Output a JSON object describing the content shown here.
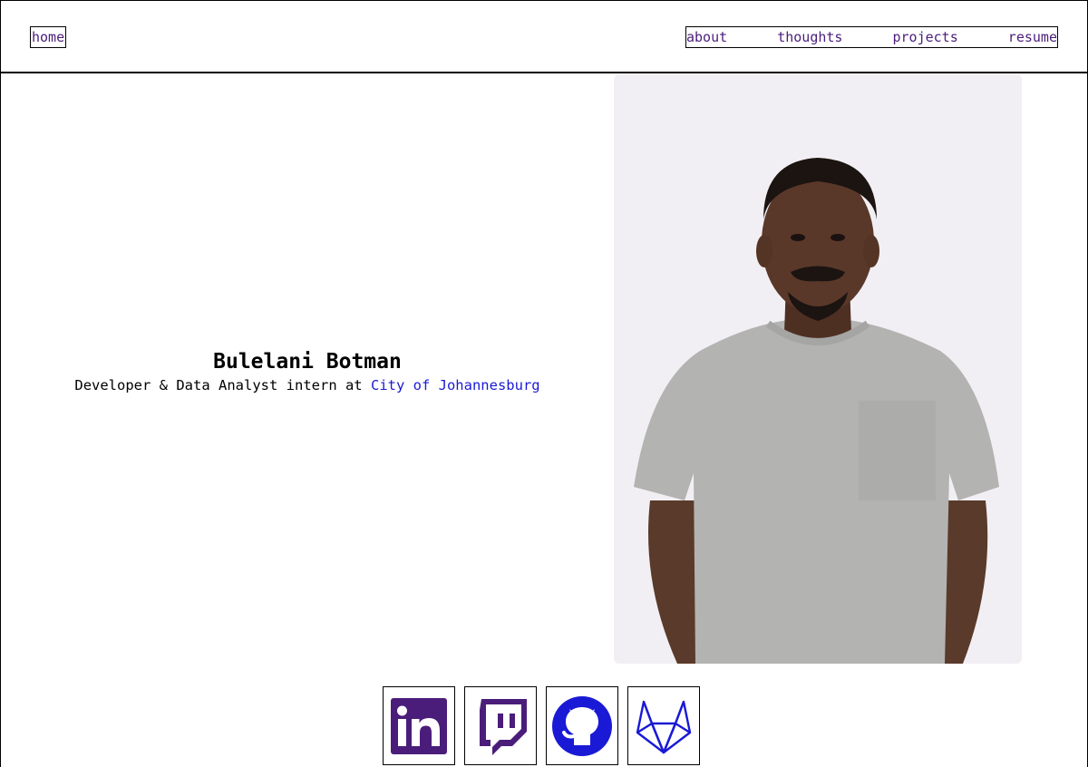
{
  "nav": {
    "home": "home",
    "links": [
      "about",
      "thoughts",
      "projects",
      "resume"
    ]
  },
  "intro": {
    "name": "Bulelani Botman",
    "tagline_prefix": "Developer & Data Analyst intern at ",
    "employer": "City of Johannesburg"
  },
  "photo": {
    "alt": "Bulelani Botman"
  },
  "socials": [
    {
      "icon": "linkedin-icon",
      "color": "#4b1d7a"
    },
    {
      "icon": "twitch-icon",
      "color": "#4b1d7a"
    },
    {
      "icon": "github-icon",
      "color": "#1a1ad6"
    },
    {
      "icon": "gitlab-icon",
      "color": "#1a1ad6"
    }
  ],
  "colors": {
    "nav_link": "#4b1d7a",
    "employer_link": "#1a1ad6",
    "photo_bg": "#f1eef3"
  }
}
